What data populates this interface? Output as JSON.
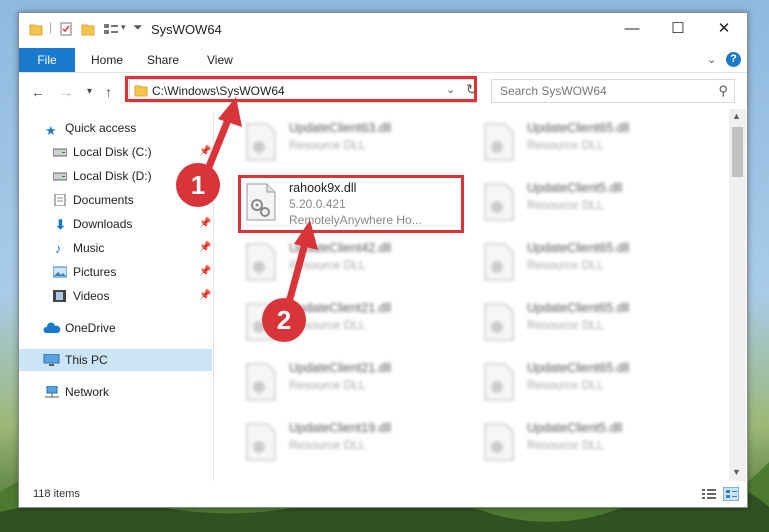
{
  "window": {
    "title": "SysWOW64"
  },
  "ribbon": {
    "file": "File",
    "home": "Home",
    "share": "Share",
    "view": "View",
    "help": "?"
  },
  "address": {
    "path": "C:\\Windows\\SysWOW64"
  },
  "search": {
    "placeholder": "Search SysWOW64"
  },
  "sidebar": {
    "items": [
      {
        "label": "Quick access",
        "icon": "star-icon"
      },
      {
        "label": "Local Disk (C:)",
        "icon": "drive-icon",
        "pinned": true
      },
      {
        "label": "Local Disk (D:)",
        "icon": "drive-icon",
        "pinned": true
      },
      {
        "label": "Documents",
        "icon": "documents-icon",
        "pinned": true
      },
      {
        "label": "Downloads",
        "icon": "downloads-icon",
        "pinned": true
      },
      {
        "label": "Music",
        "icon": "music-icon",
        "pinned": true
      },
      {
        "label": "Pictures",
        "icon": "pictures-icon",
        "pinned": true
      },
      {
        "label": "Videos",
        "icon": "videos-icon",
        "pinned": true
      },
      {
        "label": "OneDrive",
        "icon": "cloud-icon"
      },
      {
        "label": "This PC",
        "icon": "pc-icon",
        "selected": true
      },
      {
        "label": "Network",
        "icon": "network-icon"
      }
    ]
  },
  "files": {
    "left": [
      {
        "name": "UpdateClient63.dll",
        "type": "Resource DLL"
      },
      {
        "name": "rahook9x.dll",
        "version": "5.20.0.421",
        "company": "RemotelyAnywhere Ho..."
      },
      {
        "name": "UpdateClient42.dll",
        "type": "Resource DLL"
      },
      {
        "name": "UpdateClient21.dll",
        "type": "Resource DLL"
      },
      {
        "name": "UpdateClient21.dll",
        "type": "Resource DLL"
      },
      {
        "name": "UpdateClient19.dll",
        "type": "Resource DLL"
      }
    ],
    "right": [
      {
        "name": "UpdateClient65.dll",
        "type": "Resource DLL"
      },
      {
        "name": "UpdateClient5.dll",
        "type": "Resource DLL"
      },
      {
        "name": "UpdateClient65.dll",
        "type": "Resource DLL"
      },
      {
        "name": "UpdateClient65.dll",
        "type": "Resource DLL"
      },
      {
        "name": "UpdateClient65.dll",
        "type": "Resource DLL"
      },
      {
        "name": "UpdateClient5.dll",
        "type": "Resource DLL"
      }
    ]
  },
  "status": {
    "count": "118 items"
  },
  "annotations": {
    "step1": "1",
    "step2": "2"
  },
  "colors": {
    "accent": "#1979ca",
    "highlight": "#d9343a",
    "selected": "#cce4f7"
  }
}
